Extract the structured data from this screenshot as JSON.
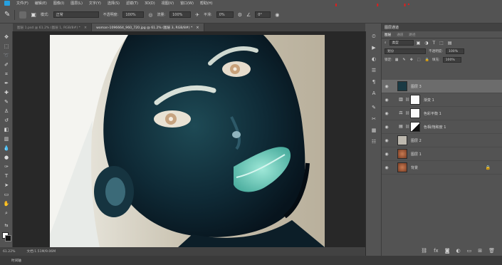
{
  "menu": [
    "文件(F)",
    "编辑(E)",
    "图像(I)",
    "图层(L)",
    "文字(Y)",
    "选择(S)",
    "滤镜(T)",
    "3D(D)",
    "视图(V)",
    "窗口(W)",
    "帮助(H)"
  ],
  "watermark": "www.heaoduodian.com",
  "options": {
    "mode_label": "模式:",
    "mode_value": "正常",
    "opacity_label": "不透明度:",
    "opacity_value": "100%",
    "flow_label": "流量:",
    "flow_value": "100%",
    "smooth_label": "平滑:",
    "smooth_value": "0%",
    "angle_value": "0°"
  },
  "tabs": [
    {
      "label": "图层 1.psd @ 61.2% (图层 1, RGB/8#) *",
      "active": false
    },
    {
      "label": "woman-1096664_960_720.jpg @ 61.2% (图层 3, RGB/8#) *",
      "active": true
    }
  ],
  "panel": {
    "title": "图层通道",
    "tabs": [
      "图层",
      "通道",
      "路径"
    ],
    "kind_label": "类型",
    "blend_mode": "划分",
    "opacity_label": "不透明度:",
    "opacity_value": "100%",
    "lock_label": "锁定:",
    "fill_label": "填充:",
    "fill_value": "100%"
  },
  "layers": [
    {
      "name": "图层 3",
      "kind": "image",
      "selected": true
    },
    {
      "name": "渐变 1",
      "kind": "gradient-adjustment",
      "selected": false
    },
    {
      "name": "色彩平衡 1",
      "kind": "balance-adjustment",
      "selected": false
    },
    {
      "name": "色相/饱和度 1",
      "kind": "hue-adjustment",
      "selected": false
    },
    {
      "name": "图层 2",
      "kind": "image",
      "selected": false
    },
    {
      "name": "图层 1",
      "kind": "image",
      "selected": false
    },
    {
      "name": "背景",
      "kind": "image",
      "selected": false,
      "locked": true
    }
  ],
  "status": {
    "zoom": "61.22%",
    "doc": "文档:1.51M/9.06M"
  },
  "bottom_label": "时间轴",
  "colors": {
    "ui_bg": "#535353",
    "canvas_bg": "#282828",
    "selected_layer": "#6c6c6c",
    "watermark": "#e21d1d"
  }
}
